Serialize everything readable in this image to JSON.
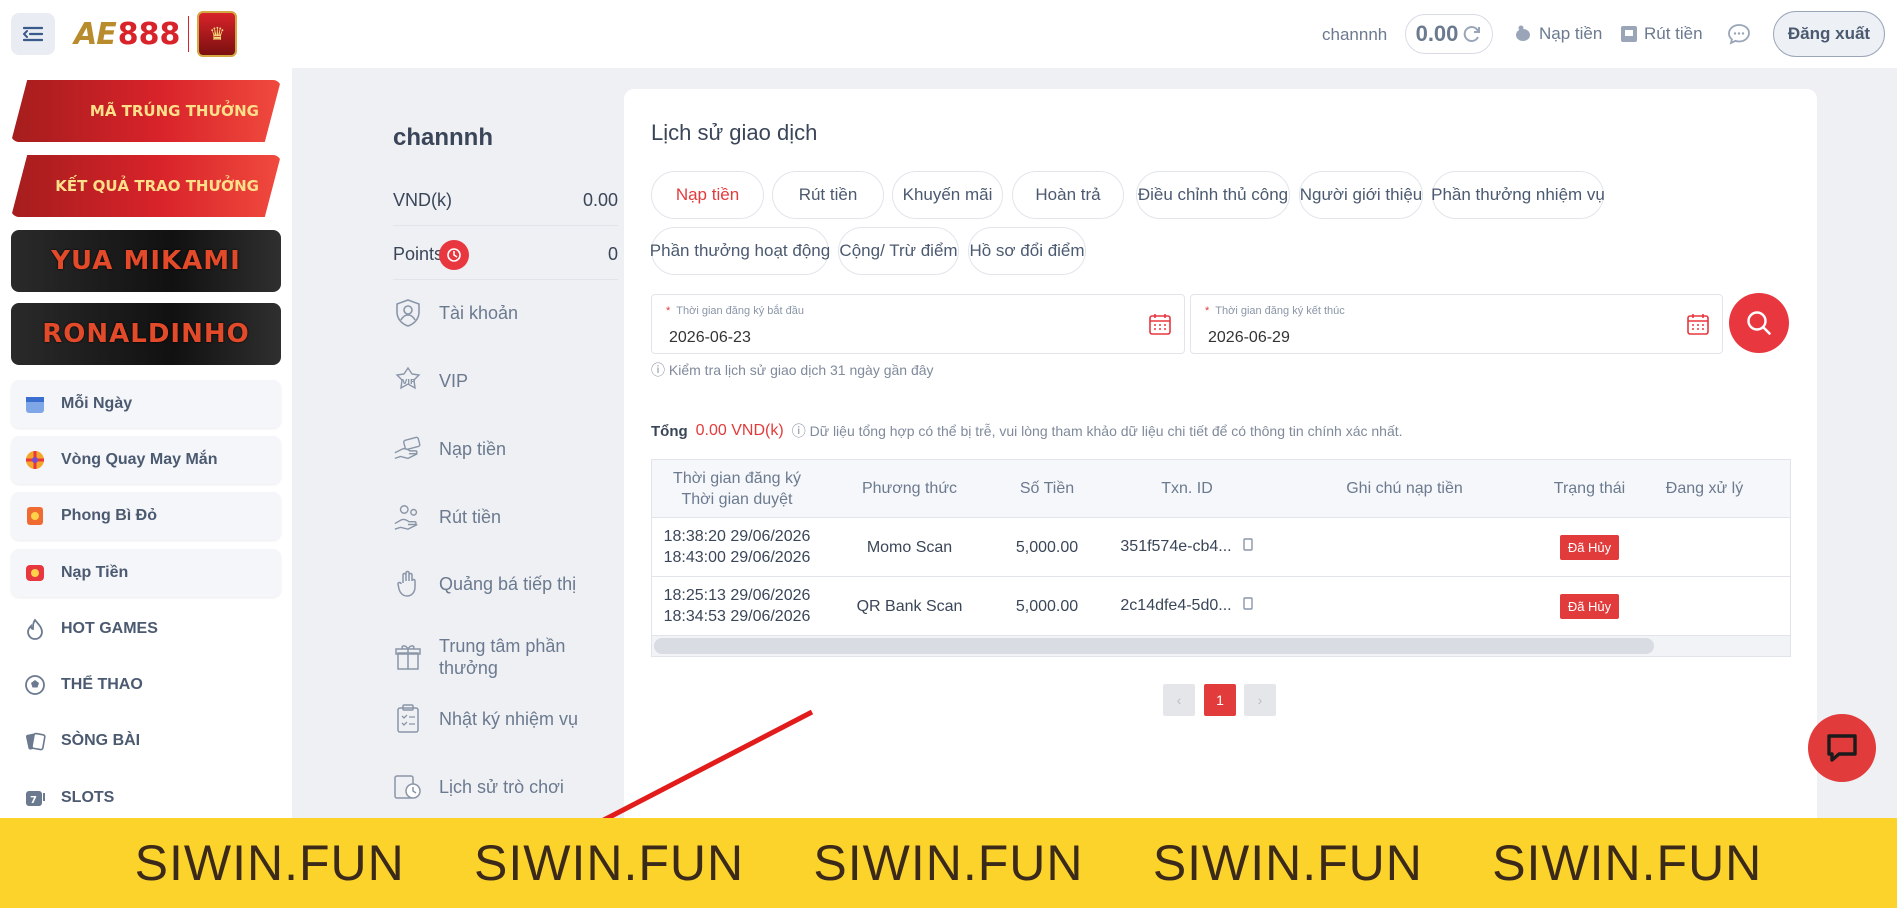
{
  "header": {
    "logo_text_ae": "AE",
    "logo_text_888": "888",
    "username": "channnh",
    "balance": "0.00",
    "deposit_label": "Nạp tiền",
    "withdraw_label": "Rút tiền",
    "logout_label": "Đăng xuất"
  },
  "sidebar": {
    "banners": [
      {
        "label": "MÃ TRÚNG THƯỞNG"
      },
      {
        "label": "KẾT QUẢ TRAO THƯỞNG"
      },
      {
        "label": "YUA MIKAMI"
      },
      {
        "label": "RONALDINHO"
      }
    ],
    "items": [
      {
        "label": "Mỗi Ngày",
        "icon": "calendar-icon"
      },
      {
        "label": "Vòng Quay May Mắn",
        "icon": "lucky-wheel-icon"
      },
      {
        "label": "Phong Bì Đỏ",
        "icon": "red-envelope-icon"
      },
      {
        "label": "Nạp Tiền",
        "icon": "deposit-icon"
      },
      {
        "label": "HOT GAMES",
        "icon": "fire-icon"
      },
      {
        "label": "THỂ THAO",
        "icon": "soccer-ball-icon"
      },
      {
        "label": "SÒNG BÀI",
        "icon": "cards-icon"
      },
      {
        "label": "SLOTS",
        "icon": "slot-icon"
      }
    ]
  },
  "account": {
    "name": "channnh",
    "currency_label": "VND(k)",
    "currency_value": "0.00",
    "points_label": "Points",
    "points_value": "0",
    "menu": [
      {
        "label": "Tài khoản",
        "icon": "account-icon"
      },
      {
        "label": "VIP",
        "icon": "vip-icon"
      },
      {
        "label": "Nạp tiền",
        "icon": "deposit-hand-icon"
      },
      {
        "label": "Rút tiền",
        "icon": "withdraw-icon"
      },
      {
        "label": "Quảng bá tiếp thị",
        "icon": "promotion-icon"
      },
      {
        "label": "Trung tâm phần thưởng",
        "icon": "gift-icon"
      },
      {
        "label": "Nhật ký nhiệm vụ",
        "icon": "clipboard-icon"
      },
      {
        "label": "Lịch sử trò chơi",
        "icon": "history-icon"
      }
    ]
  },
  "main": {
    "title": "Lịch sử giao dịch",
    "tabs": [
      {
        "label": "Nạp tiền",
        "active": true
      },
      {
        "label": "Rút tiền"
      },
      {
        "label": "Khuyến mãi"
      },
      {
        "label": "Hoàn trả"
      },
      {
        "label": "Điều chỉnh thủ công"
      },
      {
        "label": "Người giới thiệu"
      },
      {
        "label": "Phần thưởng nhiệm vụ"
      },
      {
        "label": "Phần thưởng hoạt động"
      },
      {
        "label": "Cộng/ Trừ điểm"
      },
      {
        "label": "Hồ sơ đổi điểm"
      }
    ],
    "start_date_label": "Thời gian đăng ký bắt đầu",
    "start_date_value": "2026-06-23",
    "end_date_label": "Thời gian đăng ký kết thúc",
    "end_date_value": "2026-06-29",
    "hint": "Kiểm tra lịch sử giao dịch 31 ngày gần đây",
    "total_label": "Tổng",
    "total_value": "0.00 VND(k)",
    "total_note": "Dữ liệu tổng hợp có thể bị trễ, vui lòng tham khảo dữ liệu chi tiết để có thông tin chính xác nhất.",
    "table": {
      "headers": [
        "Thời gian đăng ký",
        "Thời gian duyệt",
        "Phương thức",
        "Số Tiền",
        "Txn. ID",
        "Ghi chú nạp tiền",
        "Trạng thái",
        "Đang xử lý"
      ],
      "rows": [
        {
          "reg_time": "18:38:20 29/06/2026",
          "approve_time": "18:43:00 29/06/2026",
          "method": "Momo Scan",
          "amount": "5,000.00",
          "txn_id": "351f574e-cb4...",
          "note": "",
          "status": "Đã Hủy"
        },
        {
          "reg_time": "18:25:13 29/06/2026",
          "approve_time": "18:34:53 29/06/2026",
          "method": "QR Bank Scan",
          "amount": "5,000.00",
          "txn_id": "2c14dfe4-5d0...",
          "note": "",
          "status": "Đã Hủy"
        }
      ]
    },
    "pagination": {
      "prev": "‹",
      "current": "1",
      "next": "›"
    }
  },
  "watermark": {
    "text": [
      "SIWIN.FUN",
      "SIWIN.FUN",
      "SIWIN.FUN",
      "SIWIN.FUN",
      "SIWIN.FUN"
    ]
  },
  "colors": {
    "accent": "#e23b3b",
    "banner_yellow": "#fbd32a"
  }
}
